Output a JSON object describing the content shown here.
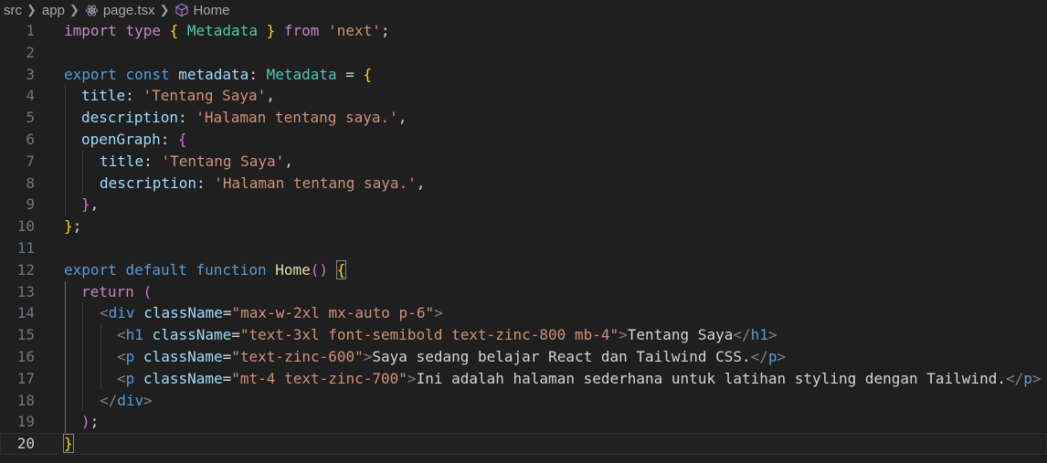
{
  "breadcrumb": {
    "items": [
      "src",
      "app",
      "page.tsx",
      "Home"
    ],
    "icons": [
      "chevron-right-icon",
      "react-icon",
      "symbol-function-icon"
    ]
  },
  "line_numbers": [
    "1",
    "2",
    "3",
    "4",
    "5",
    "6",
    "7",
    "8",
    "9",
    "10",
    "11",
    "12",
    "13",
    "14",
    "15",
    "16",
    "17",
    "18",
    "19",
    "20"
  ],
  "code": {
    "l1": {
      "import": "import",
      "type": "type",
      "lb": "{",
      "name": "Metadata",
      "rb": "}",
      "from": "from",
      "src": "'next'",
      "semi": ";"
    },
    "l3": {
      "export": "export",
      "const": "const",
      "name": "metadata",
      "colon": ": ",
      "type": "Metadata",
      "eq": " = ",
      "lb": "{"
    },
    "l4": {
      "key": "title",
      "colon": ": ",
      "val": "'Tentang Saya'",
      "comma": ","
    },
    "l5": {
      "key": "description",
      "colon": ": ",
      "val": "'Halaman tentang saya.'",
      "comma": ","
    },
    "l6": {
      "key": "openGraph",
      "colon": ": ",
      "lb": "{"
    },
    "l7": {
      "key": "title",
      "colon": ": ",
      "val": "'Tentang Saya'",
      "comma": ","
    },
    "l8": {
      "key": "description",
      "colon": ": ",
      "val": "'Halaman tentang saya.'",
      "comma": ","
    },
    "l9": {
      "rb": "}",
      "comma": ","
    },
    "l10": {
      "rb": "}",
      "semi": ";"
    },
    "l12": {
      "export": "export",
      "default": "default",
      "function": "function",
      "name": "Home",
      "parens": "()",
      "lb": "{"
    },
    "l13": {
      "return": "return",
      "lp": "("
    },
    "l14": {
      "open": "<",
      "tag": "div",
      "attr": "className",
      "eq": "=",
      "val": "\"max-w-2xl mx-auto p-6\"",
      "close": ">"
    },
    "l15": {
      "open": "<",
      "tag": "h1",
      "attr": "className",
      "eq": "=",
      "val": "\"text-3xl font-semibold text-zinc-800 mb-4\"",
      "close": ">",
      "text": "Tentang Saya",
      "end_open": "</",
      "end_tag": "h1",
      "end_close": ">"
    },
    "l16": {
      "open": "<",
      "tag": "p",
      "attr": "className",
      "eq": "=",
      "val": "\"text-zinc-600\"",
      "close": ">",
      "text": "Saya sedang belajar React dan Tailwind CSS.",
      "end_open": "</",
      "end_tag": "p",
      "end_close": ">"
    },
    "l17": {
      "open": "<",
      "tag": "p",
      "attr": "className",
      "eq": "=",
      "val": "\"mt-4 text-zinc-700\"",
      "close": ">",
      "text": "Ini adalah halaman sederhana untuk latihan styling dengan Tailwind.",
      "end_open": "</",
      "end_tag": "p",
      "end_close": ">"
    },
    "l18": {
      "end_open": "</",
      "end_tag": "div",
      "end_close": ">"
    },
    "l19": {
      "rp": ")",
      "semi": ";"
    },
    "l20": {
      "rb": "}"
    }
  }
}
